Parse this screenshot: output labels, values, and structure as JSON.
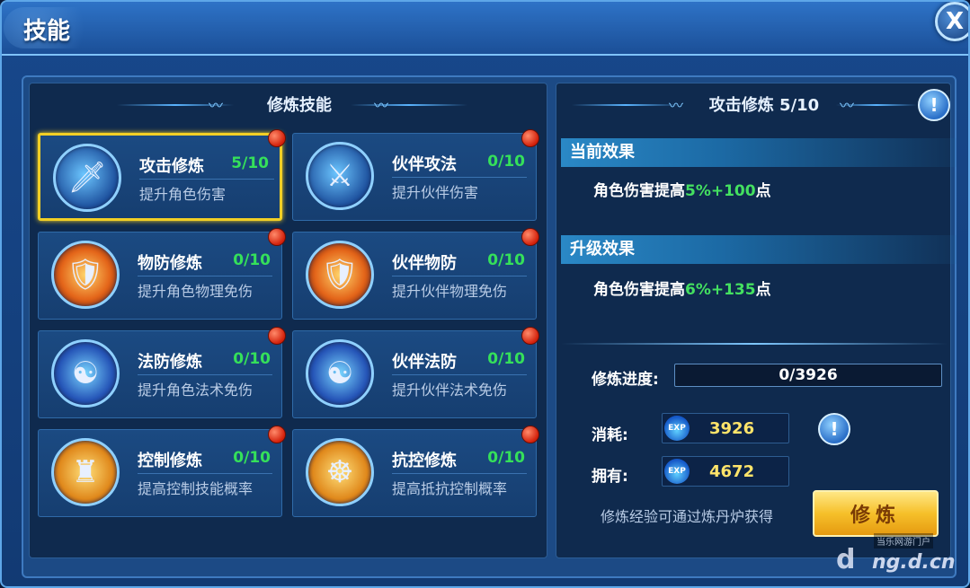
{
  "window": {
    "title": "技能",
    "close_label": "X"
  },
  "left_panel": {
    "title": "修炼技能",
    "skills": [
      {
        "name": "攻击修炼",
        "level": "5/10",
        "desc": "提升角色伤害",
        "icon": "sword-icon"
      },
      {
        "name": "伙伴攻法",
        "level": "0/10",
        "desc": "提升伙伴伤害",
        "icon": "swords-icon"
      },
      {
        "name": "物防修炼",
        "level": "0/10",
        "desc": "提升角色物理免伤",
        "icon": "armor-icon"
      },
      {
        "name": "伙伴物防",
        "level": "0/10",
        "desc": "提升伙伴物理免伤",
        "icon": "armor-pair-icon"
      },
      {
        "name": "法防修炼",
        "level": "0/10",
        "desc": "提升角色法术免伤",
        "icon": "yin-yang-figure-icon"
      },
      {
        "name": "伙伴法防",
        "level": "0/10",
        "desc": "提升伙伴法术免伤",
        "icon": "yin-yang-group-icon"
      },
      {
        "name": "控制修炼",
        "level": "0/10",
        "desc": "提高控制技能概率",
        "icon": "totem-icon"
      },
      {
        "name": "抗控修炼",
        "level": "0/10",
        "desc": "提高抵抗控制概率",
        "icon": "meditation-icon"
      }
    ]
  },
  "right_panel": {
    "title": "攻击修炼 5/10",
    "current_effect": {
      "header": "当前效果",
      "text_prefix": "角色伤害提高",
      "value": "5%+100",
      "text_suffix": "点"
    },
    "upgrade_effect": {
      "header": "升级效果",
      "text_prefix": "角色伤害提高",
      "value": "6%+135",
      "text_suffix": "点"
    },
    "progress": {
      "label": "修炼进度:",
      "text": "0/3926",
      "fraction": 0
    },
    "cost": {
      "label": "消耗:",
      "value": "3926",
      "icon": "exp-icon"
    },
    "owned": {
      "label": "拥有:",
      "value": "4672",
      "icon": "exp-icon"
    },
    "exp_badge": "EXP",
    "hint": "修炼经验可通过炼丹炉获得",
    "train_button": "修炼"
  },
  "watermark": {
    "small": "当乐网游门户",
    "logo": "d",
    "domain": "ng.d.cn"
  },
  "colors": {
    "accent_green": "#35e05a",
    "accent_gold": "#ffe46a",
    "selected_border": "#f2cf25",
    "notification_red": "#d3200a"
  }
}
